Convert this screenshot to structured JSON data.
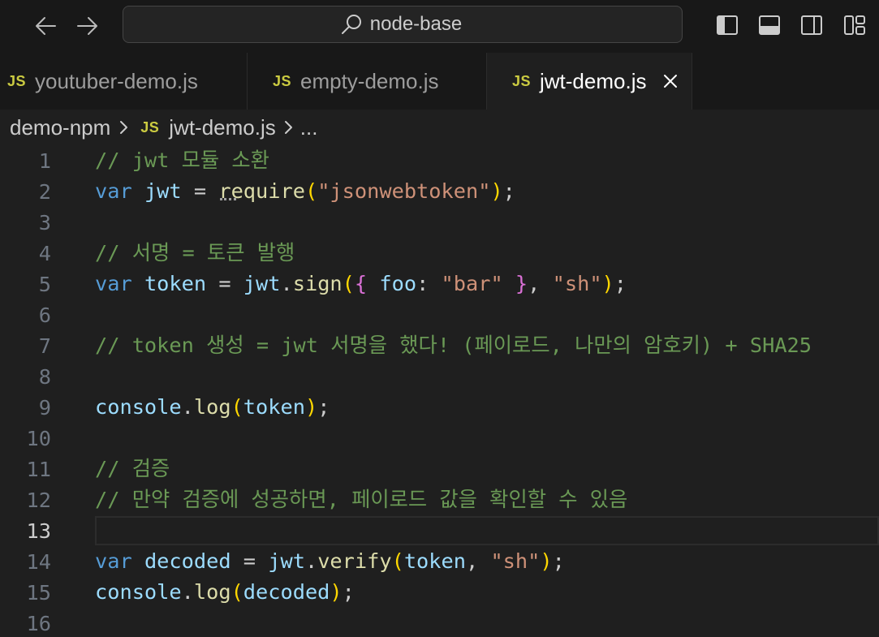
{
  "titlebar": {
    "back_icon": "arrow-left-icon",
    "forward_icon": "arrow-right-icon",
    "search_icon": "search-icon",
    "search_text": "node-base",
    "layout_icons": [
      "toggle-primary-sidebar-icon",
      "toggle-panel-icon",
      "toggle-secondary-sidebar-icon",
      "customize-layout-icon"
    ]
  },
  "tabs": [
    {
      "icon": "JS",
      "label": "youtuber-demo.js",
      "active": false
    },
    {
      "icon": "JS",
      "label": "empty-demo.js",
      "active": false
    },
    {
      "icon": "JS",
      "label": "jwt-demo.js",
      "active": true,
      "close_icon": "close-icon"
    }
  ],
  "breadcrumb": {
    "folder": "demo-npm",
    "file_icon": "JS",
    "file": "jwt-demo.js",
    "more": "..."
  },
  "editor": {
    "active_line": 13,
    "lines": [
      {
        "number": 1,
        "tokens": [
          {
            "t": "comment",
            "v": "// jwt 모듈 소환"
          }
        ]
      },
      {
        "number": 2,
        "tokens": [
          {
            "t": "keyword",
            "v": "var"
          },
          {
            "t": "punctuation",
            "v": " "
          },
          {
            "t": "variable",
            "v": "jwt"
          },
          {
            "t": "punctuation",
            "v": " = "
          },
          {
            "t": "function",
            "v": "require",
            "hint": true
          },
          {
            "t": "bracket-1",
            "v": "("
          },
          {
            "t": "string",
            "v": "\"jsonwebtoken\""
          },
          {
            "t": "bracket-1",
            "v": ")"
          },
          {
            "t": "punctuation",
            "v": ";"
          }
        ]
      },
      {
        "number": 3,
        "tokens": []
      },
      {
        "number": 4,
        "tokens": [
          {
            "t": "comment",
            "v": "// 서명 = 토큰 발행"
          }
        ]
      },
      {
        "number": 5,
        "tokens": [
          {
            "t": "keyword",
            "v": "var"
          },
          {
            "t": "punctuation",
            "v": " "
          },
          {
            "t": "variable",
            "v": "token"
          },
          {
            "t": "punctuation",
            "v": " = "
          },
          {
            "t": "variable",
            "v": "jwt"
          },
          {
            "t": "punctuation",
            "v": "."
          },
          {
            "t": "function",
            "v": "sign"
          },
          {
            "t": "bracket-1",
            "v": "("
          },
          {
            "t": "bracket-2",
            "v": "{"
          },
          {
            "t": "punctuation",
            "v": " "
          },
          {
            "t": "variable",
            "v": "foo"
          },
          {
            "t": "punctuation",
            "v": ": "
          },
          {
            "t": "string",
            "v": "\"bar\""
          },
          {
            "t": "punctuation",
            "v": " "
          },
          {
            "t": "bracket-2",
            "v": "}"
          },
          {
            "t": "punctuation",
            "v": ", "
          },
          {
            "t": "string",
            "v": "\"sh\""
          },
          {
            "t": "bracket-1",
            "v": ")"
          },
          {
            "t": "punctuation",
            "v": ";"
          }
        ]
      },
      {
        "number": 6,
        "tokens": []
      },
      {
        "number": 7,
        "tokens": [
          {
            "t": "comment",
            "v": "// token 생성 = jwt 서명을 했다! (페이로드, 나만의 암호키) + SHA25"
          }
        ]
      },
      {
        "number": 8,
        "tokens": []
      },
      {
        "number": 9,
        "tokens": [
          {
            "t": "variable",
            "v": "console"
          },
          {
            "t": "punctuation",
            "v": "."
          },
          {
            "t": "function",
            "v": "log"
          },
          {
            "t": "bracket-1",
            "v": "("
          },
          {
            "t": "variable",
            "v": "token"
          },
          {
            "t": "bracket-1",
            "v": ")"
          },
          {
            "t": "punctuation",
            "v": ";"
          }
        ]
      },
      {
        "number": 10,
        "tokens": []
      },
      {
        "number": 11,
        "tokens": [
          {
            "t": "comment",
            "v": "// 검증"
          }
        ]
      },
      {
        "number": 12,
        "tokens": [
          {
            "t": "comment",
            "v": "// 만약 검증에 성공하면, 페이로드 값을 확인할 수 있음"
          }
        ]
      },
      {
        "number": 13,
        "tokens": []
      },
      {
        "number": 14,
        "tokens": [
          {
            "t": "keyword",
            "v": "var"
          },
          {
            "t": "punctuation",
            "v": " "
          },
          {
            "t": "variable",
            "v": "decoded"
          },
          {
            "t": "punctuation",
            "v": " = "
          },
          {
            "t": "variable",
            "v": "jwt"
          },
          {
            "t": "punctuation",
            "v": "."
          },
          {
            "t": "function",
            "v": "verify"
          },
          {
            "t": "bracket-1",
            "v": "("
          },
          {
            "t": "variable",
            "v": "token"
          },
          {
            "t": "punctuation",
            "v": ", "
          },
          {
            "t": "string",
            "v": "\"sh\""
          },
          {
            "t": "bracket-1",
            "v": ")"
          },
          {
            "t": "punctuation",
            "v": ";"
          }
        ]
      },
      {
        "number": 15,
        "tokens": [
          {
            "t": "variable",
            "v": "console"
          },
          {
            "t": "punctuation",
            "v": "."
          },
          {
            "t": "function",
            "v": "log"
          },
          {
            "t": "bracket-1",
            "v": "("
          },
          {
            "t": "variable",
            "v": "decoded"
          },
          {
            "t": "bracket-1",
            "v": ")"
          },
          {
            "t": "punctuation",
            "v": ";"
          }
        ]
      },
      {
        "number": 16,
        "tokens": []
      }
    ]
  },
  "colors": {
    "comment": "#6a9955",
    "keyword": "#569cd6",
    "variable": "#9cdcfe",
    "function": "#dcdcaa",
    "string": "#ce9178",
    "punctuation": "#cccccc",
    "bracket-1": "#ffd700",
    "bracket-2": "#da70d6",
    "js-icon": "#cbcb41",
    "line-number": "#6e7681",
    "line-number-active": "#cccccc",
    "editor-background": "#1f1f1f"
  }
}
